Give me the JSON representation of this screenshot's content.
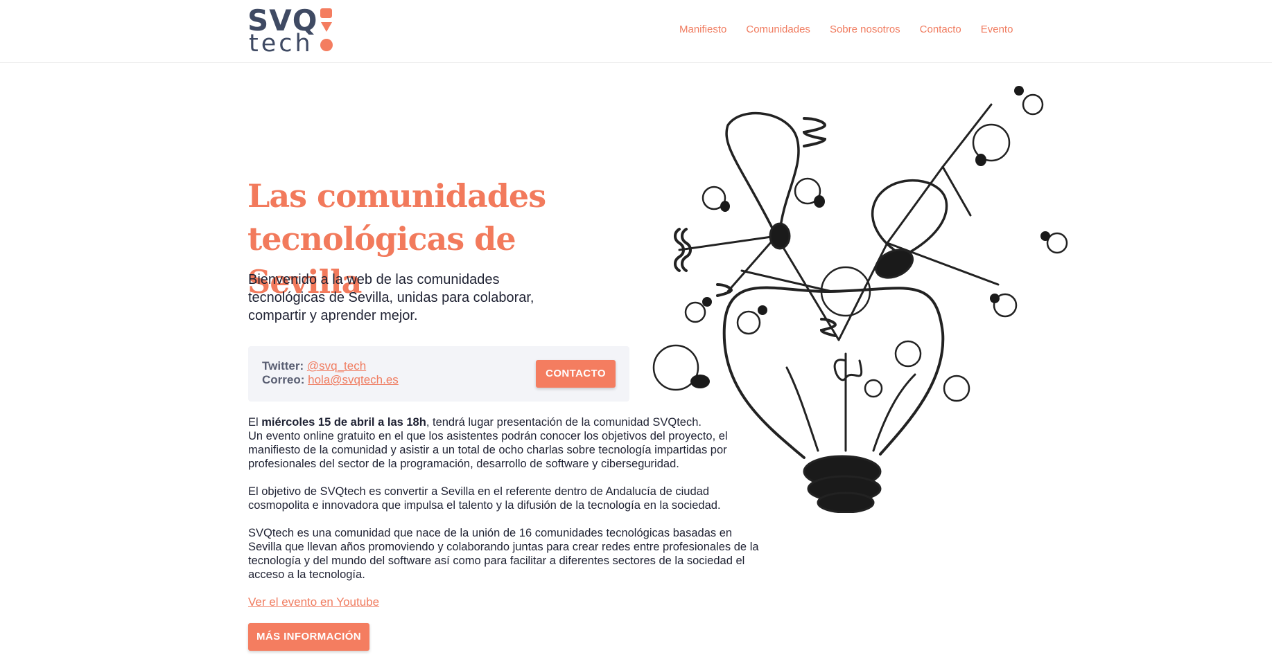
{
  "brand": {
    "logo_top": "SVQ",
    "logo_bottom": "tech",
    "accent": "#f27a5c",
    "dark": "#3f4a63"
  },
  "nav": {
    "items": [
      {
        "label": "Manifiesto"
      },
      {
        "label": "Comunidades"
      },
      {
        "label": "Sobre nosotros"
      },
      {
        "label": "Contacto"
      },
      {
        "label": "Evento"
      }
    ]
  },
  "hero": {
    "title_line1": "Las comunidades",
    "title_line2": "tecnológicas de Sevilla",
    "intro": "Bienvenido a la web de las comunidades tecnológicas de Sevilla, unidas para colaborar, compartir y aprender mejor."
  },
  "contact": {
    "twitter_label": "Twitter:",
    "twitter_value": "@svq_tech",
    "email_label": "Correo:",
    "email_value": "hola@svqtech.es",
    "button_label": "CONTACTO"
  },
  "event": {
    "p1_prefix": "El ",
    "p1_bold": "miércoles 15 de abril a las 18h",
    "p1_rest": ", tendrá lugar presentación de la comunidad SVQtech.",
    "p1_line2": "Un evento online gratuito en el que los asistentes podrán conocer los objetivos del proyecto, el manifiesto de la comunidad y asistir a un total de ocho charlas sobre tecnología impartidas por profesionales del sector de la programación, desarrollo de software y ciberseguridad.",
    "p2": "El objetivo de SVQtech es convertir a Sevilla en el referente dentro de Andalucía de ciudad cosmopolita e innovadora que impulsa el talento y la difusión de la tecnología en la sociedad.",
    "p3": "SVQtech es una comunidad que nace de la unión de 16 comunidades tecnológicas basadas en Sevilla que llevan años promoviendo y colaborando juntas para crear redes entre profesionales de la tecnología y del mundo del software así como para facilitar a diferentes sectores de la sociedad el acceso a la tecnología.",
    "youtube_link": "Ver el evento en Youtube",
    "more_button": "MÁS INFORMACIÓN"
  },
  "illustration": {
    "icon": "lightbulbs-illustration"
  }
}
